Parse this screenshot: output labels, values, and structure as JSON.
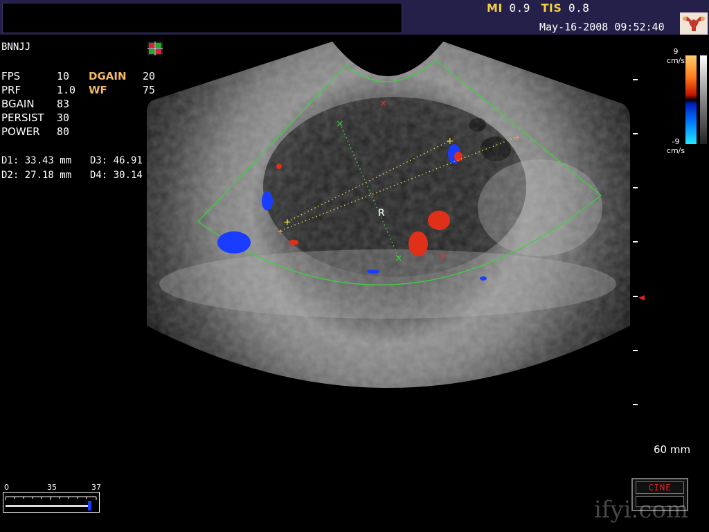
{
  "header": {
    "mi_label": "MI",
    "mi_value": "0.9",
    "tis_label": "TIS",
    "tis_value": "0.8",
    "datetime": "May-16-2008 09:52:40"
  },
  "probe": {
    "name": "BNNJJ"
  },
  "params": {
    "fps_label": "FPS",
    "fps_value": "10",
    "dgain_label": "DGAIN",
    "dgain_value": "20",
    "prf_label": "PRF",
    "prf_value": "1.0",
    "wf_label": "WF",
    "wf_value": "75",
    "bgain_label": "BGAIN",
    "bgain_value": "83",
    "persist_label": "PERSIST",
    "persist_value": "30",
    "power_label": "POWER",
    "power_value": "80"
  },
  "measurements": {
    "d1": "D1: 33.43 mm",
    "d2": "D2: 27.18 mm",
    "d3": "D3: 46.91 mm",
    "d4": "D4: 30.14 mm"
  },
  "color_scale": {
    "top_value": "9",
    "top_unit": "cm/s",
    "bottom_value": "-9",
    "bottom_unit": "cm/s"
  },
  "image": {
    "region_label": "R"
  },
  "depth": {
    "label": "60 mm"
  },
  "slider": {
    "min": "0",
    "mid": "35",
    "max": "37"
  },
  "cine": {
    "label": "CINE"
  },
  "watermark": "ifyi.com",
  "colors": {
    "accent_yellow": "#f4d03f",
    "accent_orange": "#f5b866",
    "doppler_red": "#e0301a",
    "doppler_blue": "#1a3cff",
    "roi_green": "#3cd23c"
  }
}
